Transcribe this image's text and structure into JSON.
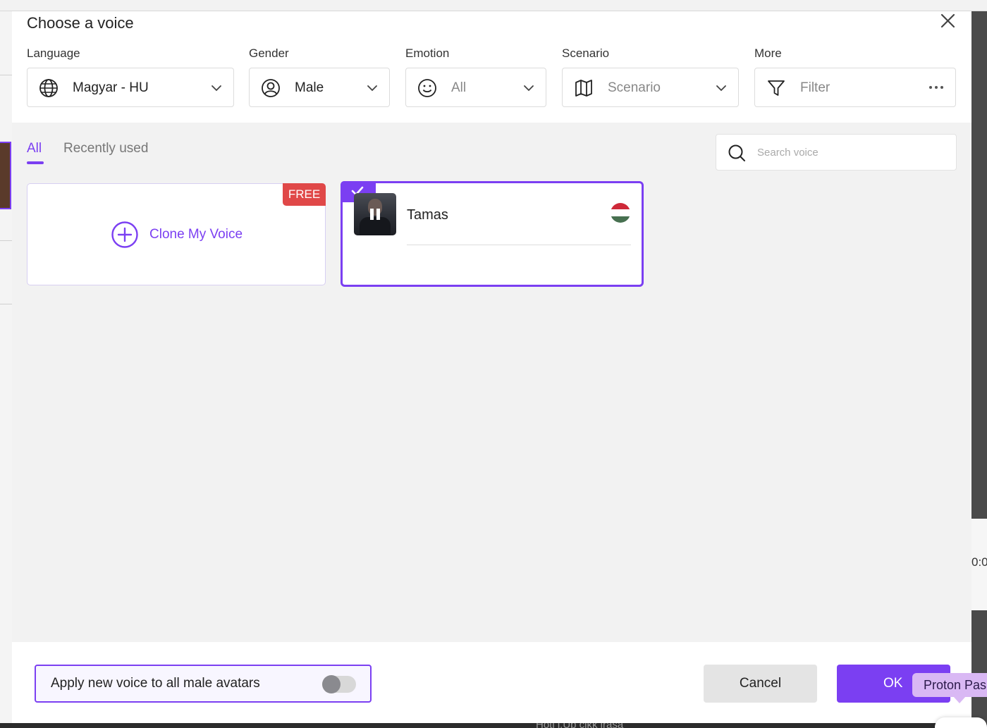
{
  "dialog": {
    "title": "Choose a voice"
  },
  "filters": {
    "language": {
      "label": "Language",
      "value": "Magyar - HU",
      "icon": "globe-icon"
    },
    "gender": {
      "label": "Gender",
      "value": "Male",
      "icon": "user-circle-icon"
    },
    "emotion": {
      "label": "Emotion",
      "value": "All",
      "icon": "smiley-icon"
    },
    "scenario": {
      "label": "Scenario",
      "value": "Scenario",
      "icon": "map-icon"
    },
    "more": {
      "label": "More",
      "value": "Filter",
      "icon": "filter-icon"
    }
  },
  "tabs": [
    {
      "label": "All",
      "active": true
    },
    {
      "label": "Recently used",
      "active": false
    }
  ],
  "search": {
    "placeholder": "Search voice",
    "value": ""
  },
  "clone_card": {
    "badge": "FREE",
    "label": "Clone My Voice"
  },
  "voices": [
    {
      "name": "Tamas",
      "selected": true,
      "playing": true,
      "flag": "hungary-flag"
    }
  ],
  "footer": {
    "apply_label": "Apply new voice to all male avatars",
    "apply_toggle": false,
    "cancel_label": "Cancel",
    "ok_label": "OK"
  },
  "overlay": {
    "label": "Proton Pas"
  },
  "background": {
    "time_fragment": "0:0",
    "bottom_text": "Hotl i,Ub cikk irasa"
  },
  "colors": {
    "accent": "#7b3ff2",
    "badge": "#e04848",
    "flag": [
      "#ce2939",
      "#ffffff",
      "#477050"
    ]
  }
}
